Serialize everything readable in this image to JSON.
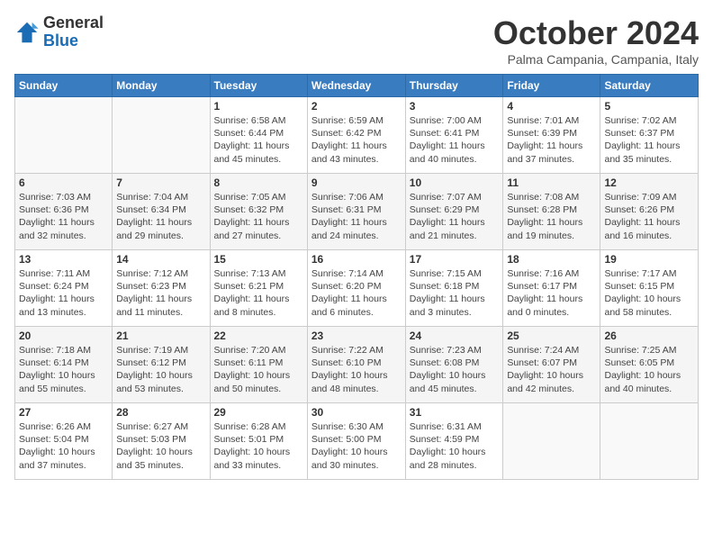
{
  "logo": {
    "general": "General",
    "blue": "Blue"
  },
  "header": {
    "month": "October 2024",
    "location": "Palma Campania, Campania, Italy"
  },
  "weekdays": [
    "Sunday",
    "Monday",
    "Tuesday",
    "Wednesday",
    "Thursday",
    "Friday",
    "Saturday"
  ],
  "weeks": [
    [
      {
        "day": "",
        "info": ""
      },
      {
        "day": "",
        "info": ""
      },
      {
        "day": "1",
        "info": "Sunrise: 6:58 AM\nSunset: 6:44 PM\nDaylight: 11 hours\nand 45 minutes."
      },
      {
        "day": "2",
        "info": "Sunrise: 6:59 AM\nSunset: 6:42 PM\nDaylight: 11 hours\nand 43 minutes."
      },
      {
        "day": "3",
        "info": "Sunrise: 7:00 AM\nSunset: 6:41 PM\nDaylight: 11 hours\nand 40 minutes."
      },
      {
        "day": "4",
        "info": "Sunrise: 7:01 AM\nSunset: 6:39 PM\nDaylight: 11 hours\nand 37 minutes."
      },
      {
        "day": "5",
        "info": "Sunrise: 7:02 AM\nSunset: 6:37 PM\nDaylight: 11 hours\nand 35 minutes."
      }
    ],
    [
      {
        "day": "6",
        "info": "Sunrise: 7:03 AM\nSunset: 6:36 PM\nDaylight: 11 hours\nand 32 minutes."
      },
      {
        "day": "7",
        "info": "Sunrise: 7:04 AM\nSunset: 6:34 PM\nDaylight: 11 hours\nand 29 minutes."
      },
      {
        "day": "8",
        "info": "Sunrise: 7:05 AM\nSunset: 6:32 PM\nDaylight: 11 hours\nand 27 minutes."
      },
      {
        "day": "9",
        "info": "Sunrise: 7:06 AM\nSunset: 6:31 PM\nDaylight: 11 hours\nand 24 minutes."
      },
      {
        "day": "10",
        "info": "Sunrise: 7:07 AM\nSunset: 6:29 PM\nDaylight: 11 hours\nand 21 minutes."
      },
      {
        "day": "11",
        "info": "Sunrise: 7:08 AM\nSunset: 6:28 PM\nDaylight: 11 hours\nand 19 minutes."
      },
      {
        "day": "12",
        "info": "Sunrise: 7:09 AM\nSunset: 6:26 PM\nDaylight: 11 hours\nand 16 minutes."
      }
    ],
    [
      {
        "day": "13",
        "info": "Sunrise: 7:11 AM\nSunset: 6:24 PM\nDaylight: 11 hours\nand 13 minutes."
      },
      {
        "day": "14",
        "info": "Sunrise: 7:12 AM\nSunset: 6:23 PM\nDaylight: 11 hours\nand 11 minutes."
      },
      {
        "day": "15",
        "info": "Sunrise: 7:13 AM\nSunset: 6:21 PM\nDaylight: 11 hours\nand 8 minutes."
      },
      {
        "day": "16",
        "info": "Sunrise: 7:14 AM\nSunset: 6:20 PM\nDaylight: 11 hours\nand 6 minutes."
      },
      {
        "day": "17",
        "info": "Sunrise: 7:15 AM\nSunset: 6:18 PM\nDaylight: 11 hours\nand 3 minutes."
      },
      {
        "day": "18",
        "info": "Sunrise: 7:16 AM\nSunset: 6:17 PM\nDaylight: 11 hours\nand 0 minutes."
      },
      {
        "day": "19",
        "info": "Sunrise: 7:17 AM\nSunset: 6:15 PM\nDaylight: 10 hours\nand 58 minutes."
      }
    ],
    [
      {
        "day": "20",
        "info": "Sunrise: 7:18 AM\nSunset: 6:14 PM\nDaylight: 10 hours\nand 55 minutes."
      },
      {
        "day": "21",
        "info": "Sunrise: 7:19 AM\nSunset: 6:12 PM\nDaylight: 10 hours\nand 53 minutes."
      },
      {
        "day": "22",
        "info": "Sunrise: 7:20 AM\nSunset: 6:11 PM\nDaylight: 10 hours\nand 50 minutes."
      },
      {
        "day": "23",
        "info": "Sunrise: 7:22 AM\nSunset: 6:10 PM\nDaylight: 10 hours\nand 48 minutes."
      },
      {
        "day": "24",
        "info": "Sunrise: 7:23 AM\nSunset: 6:08 PM\nDaylight: 10 hours\nand 45 minutes."
      },
      {
        "day": "25",
        "info": "Sunrise: 7:24 AM\nSunset: 6:07 PM\nDaylight: 10 hours\nand 42 minutes."
      },
      {
        "day": "26",
        "info": "Sunrise: 7:25 AM\nSunset: 6:05 PM\nDaylight: 10 hours\nand 40 minutes."
      }
    ],
    [
      {
        "day": "27",
        "info": "Sunrise: 6:26 AM\nSunset: 5:04 PM\nDaylight: 10 hours\nand 37 minutes."
      },
      {
        "day": "28",
        "info": "Sunrise: 6:27 AM\nSunset: 5:03 PM\nDaylight: 10 hours\nand 35 minutes."
      },
      {
        "day": "29",
        "info": "Sunrise: 6:28 AM\nSunset: 5:01 PM\nDaylight: 10 hours\nand 33 minutes."
      },
      {
        "day": "30",
        "info": "Sunrise: 6:30 AM\nSunset: 5:00 PM\nDaylight: 10 hours\nand 30 minutes."
      },
      {
        "day": "31",
        "info": "Sunrise: 6:31 AM\nSunset: 4:59 PM\nDaylight: 10 hours\nand 28 minutes."
      },
      {
        "day": "",
        "info": ""
      },
      {
        "day": "",
        "info": ""
      }
    ]
  ]
}
